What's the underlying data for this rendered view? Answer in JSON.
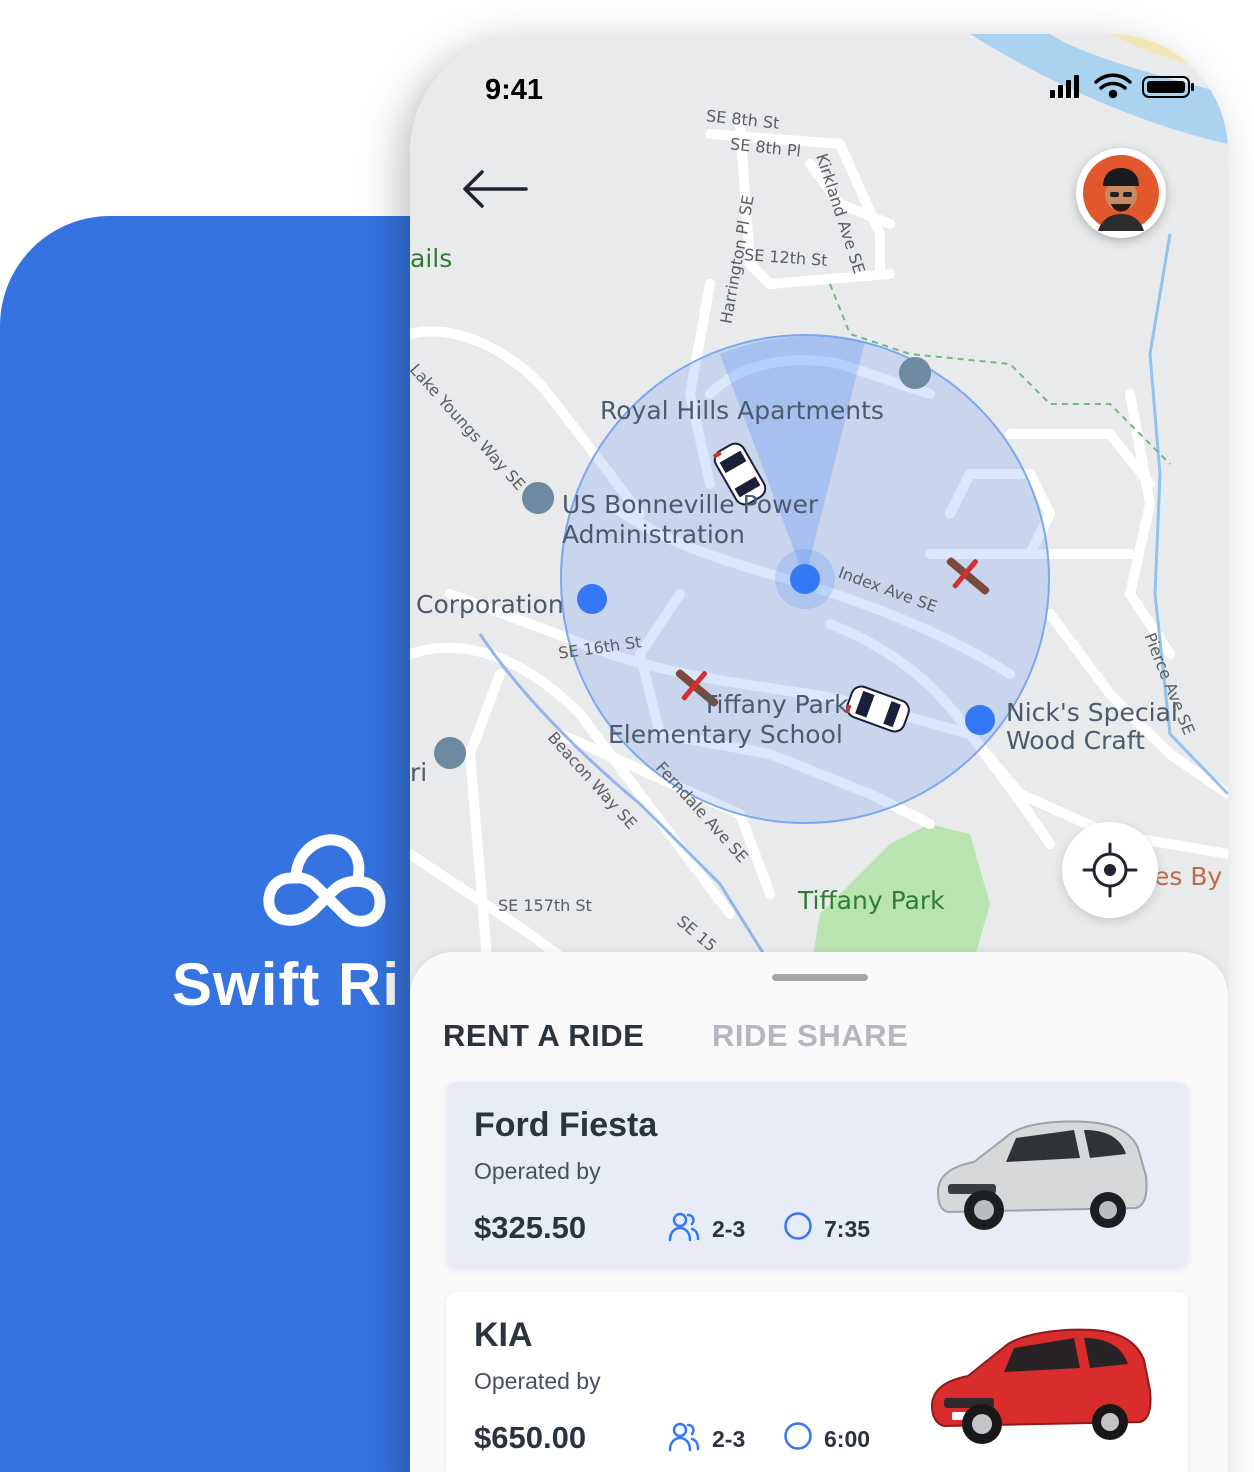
{
  "brand": {
    "name": "Swift Ri",
    "logo_icon": "cloud-infinity-icon",
    "background_color": "#3473e0"
  },
  "status_bar": {
    "time": "9:41",
    "icons": [
      "cellular-signal-icon",
      "wifi-icon",
      "battery-icon"
    ]
  },
  "map": {
    "pois": {
      "royal_hills": "Royal Hills Apartments",
      "bonneville_line1": "US Bonneville Power",
      "bonneville_line2": "Administration",
      "corporation": "Corporation",
      "tiffany_school_line1": "Tiffany Park",
      "tiffany_school_line2": "Elementary School",
      "nicks_line1": "Nick's Special",
      "nicks_line2": "Wood Craft",
      "tiffany_park": "Tiffany Park",
      "trails_fragment": "ails",
      "ri_fragment": "ri",
      "es_by_fragment": "es By"
    },
    "streets": {
      "se_8th_st": "SE 8th St",
      "se_8th_pl": "SE 8th Pl",
      "kirkland": "Kirkland Ave SE",
      "harrington": "Harrington Pl SE",
      "se_12th": "SE 12th St",
      "lake_youngs": "Lake Youngs Way SE",
      "index_ave": "Index Ave SE",
      "se_16th": "SE 16th St",
      "beacon_way": "Beacon Way SE",
      "ferndale": "Ferndale Ave SE",
      "pierce": "Pierce Ave SE",
      "se_157th": "SE 157th St",
      "se_15_fragment": "SE 15"
    },
    "accent_color": "#3478f6"
  },
  "sheet": {
    "tabs": [
      {
        "label": "RENT A RIDE",
        "active": true
      },
      {
        "label": "RIDE SHARE",
        "active": false
      }
    ],
    "rides": [
      {
        "name": "Ford Fiesta",
        "operator_label": "Operated by",
        "price": "$325.50",
        "seats": "2-3",
        "duration": "7:35",
        "car_color": "silver"
      },
      {
        "name": "KIA",
        "operator_label": "Operated by",
        "price": "$650.00",
        "seats": "2-3",
        "duration": "6:00",
        "car_color": "red"
      }
    ]
  }
}
